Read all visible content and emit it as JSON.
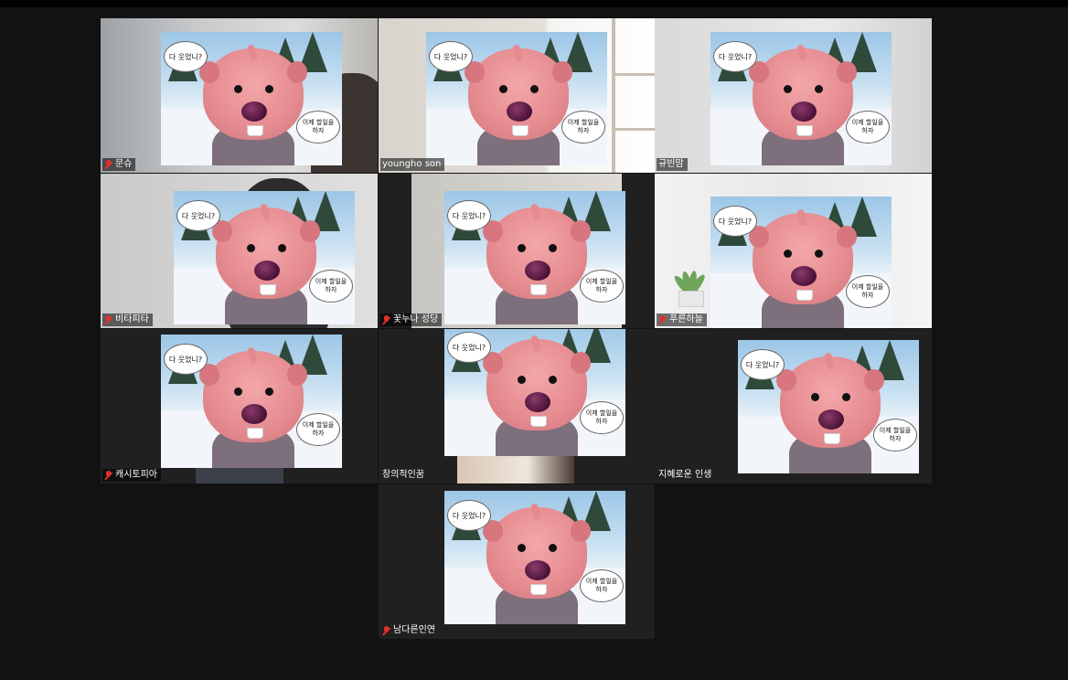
{
  "meeting": {
    "speech_question": "다 웃었니?",
    "speech_answer": "이제 할일을\n하자",
    "participants": [
      {
        "name": "문슈",
        "muted": true,
        "active": false
      },
      {
        "name": "youngho son",
        "muted": false,
        "active": false
      },
      {
        "name": "규빈맘",
        "muted": false,
        "active": false
      },
      {
        "name": "비타피타",
        "muted": true,
        "active": false
      },
      {
        "name": "꽃누나 성당",
        "muted": true,
        "active": false
      },
      {
        "name": "푸른하늘",
        "muted": true,
        "active": true
      },
      {
        "name": "캐시토피아",
        "muted": true,
        "active": false
      },
      {
        "name": "창의적인꿈",
        "muted": false,
        "active": false
      },
      {
        "name": "지혜로운 인생",
        "muted": false,
        "active": false
      },
      {
        "name": "남다른인연",
        "muted": true,
        "active": false
      }
    ]
  },
  "colors": {
    "active_speaker_border": "#23d962",
    "muted_icon": "#e0312b",
    "background": "#121212"
  },
  "icons": {
    "muted": "microphone-muted-icon"
  }
}
